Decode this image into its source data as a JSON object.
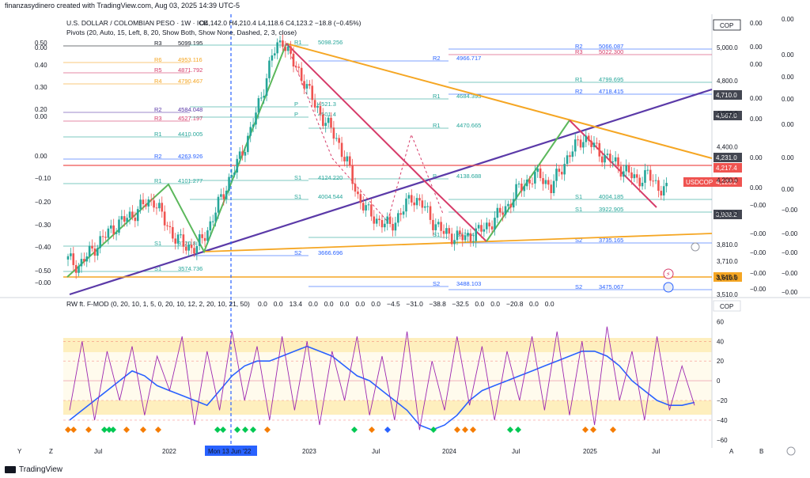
{
  "header": {
    "created_by": "finanzasydinero created with TradingView.com, Aug 03, 2025 14:39 UTC-5"
  },
  "footer": {
    "brand": "TradingView"
  },
  "legend": {
    "symbol": "U.S. DOLLAR / COLOMBIAN PESO · 1W · ICE",
    "ohlc": "O4,142.0  H4,210.4  L4,118.6  C4,123.2  −18.8 (−0.45%)",
    "pivots": "Pivots (20, Auto, 15, Left, 8, 20, Show Both, Show None, Dashed, 2, 3, close)",
    "oscillator": "RW ft. F-MOD (0, 20, 10, 1, 5, 0, 20, 10, 12, 2, 20, 10, 21, 50)",
    "osc_values": [
      "0.0",
      "0.0",
      "13.4",
      "0.0",
      "0.0",
      "0.0",
      "0.0",
      "0.0",
      "−4.5",
      "−31.0",
      "−38.8",
      "−32.5",
      "0.0",
      "0.0",
      "−20.8",
      "0.0",
      "0.0"
    ]
  },
  "colors": {
    "bull": "#26a69a",
    "bear": "#ef5350",
    "purple": "#5b3aa8",
    "orange": "#f5a623",
    "pink": "#d63c6a",
    "green": "#5cb85c",
    "blue": "#2962ff",
    "band": "#fff3c4"
  },
  "chart_data": [
    {
      "type": "candlestick",
      "title": "U.S. DOLLAR / COLOMBIAN PESO · 1W · ICE",
      "currency": "COP",
      "x_ticks": [
        "Jul",
        "2022",
        "Mon 13 Jun '22",
        "2023",
        "Jul",
        "2024",
        "Jul",
        "2025",
        "Jul"
      ],
      "y_ticks": [
        "5,000.0",
        "4,800.0",
        "4,600.0",
        "4,400.0",
        "4,200.0",
        "4,000.0",
        "3,810.0",
        "3,710.0",
        "3,610.0",
        "3,510.0"
      ],
      "y_min": 3500,
      "y_max": 5200,
      "last": {
        "label": "USDCOP",
        "value": "4,123.2"
      },
      "price_labels": [
        "4,710.0",
        "4,567.0",
        "4,231.0",
        "4,217.4",
        "3,908.2",
        "3,545.5"
      ],
      "close_path": [
        [
          0,
          3720
        ],
        [
          4,
          3680
        ],
        [
          8,
          3760
        ],
        [
          12,
          3830
        ],
        [
          16,
          3900
        ],
        [
          20,
          3950
        ],
        [
          24,
          3990
        ],
        [
          28,
          4050
        ],
        [
          32,
          4080
        ],
        [
          36,
          3950
        ],
        [
          40,
          3850
        ],
        [
          44,
          3800
        ],
        [
          48,
          3790
        ],
        [
          52,
          3900
        ],
        [
          56,
          4050
        ],
        [
          60,
          4200
        ],
        [
          64,
          4330
        ],
        [
          68,
          4500
        ],
        [
          72,
          4700
        ],
        [
          76,
          4950
        ],
        [
          80,
          5050
        ],
        [
          84,
          4900
        ],
        [
          88,
          4800
        ],
        [
          92,
          4650
        ],
        [
          96,
          4550
        ],
        [
          100,
          4450
        ],
        [
          104,
          4300
        ],
        [
          108,
          4100
        ],
        [
          112,
          4000
        ],
        [
          116,
          3950
        ],
        [
          120,
          3920
        ],
        [
          124,
          4000
        ],
        [
          128,
          4100
        ],
        [
          132,
          4050
        ],
        [
          136,
          3950
        ],
        [
          140,
          3880
        ],
        [
          144,
          3860
        ],
        [
          148,
          3850
        ],
        [
          152,
          3880
        ],
        [
          156,
          3920
        ],
        [
          160,
          3980
        ],
        [
          164,
          4050
        ],
        [
          168,
          4150
        ],
        [
          172,
          4200
        ],
        [
          176,
          4230
        ],
        [
          180,
          4150
        ],
        [
          184,
          4280
        ],
        [
          188,
          4380
        ],
        [
          192,
          4460
        ],
        [
          196,
          4400
        ],
        [
          200,
          4340
        ],
        [
          204,
          4300
        ],
        [
          208,
          4250
        ],
        [
          212,
          4200
        ],
        [
          216,
          4230
        ],
        [
          220,
          4160
        ],
        [
          224,
          4125
        ]
      ],
      "pivot_labels": [
        {
          "name": "R3",
          "value": "5099.195"
        },
        {
          "name": "R6",
          "value": "4953.116"
        },
        {
          "name": "R5",
          "value": "4871.792"
        },
        {
          "name": "R4",
          "value": "4790.467"
        },
        {
          "name": "R2",
          "value": "4584.048"
        },
        {
          "name": "R3",
          "value": "4527.197"
        },
        {
          "name": "R1",
          "value": "4410.005"
        },
        {
          "name": "R2",
          "value": "4263.926"
        },
        {
          "name": "R1",
          "value": "4101.277"
        },
        {
          "name": "S1",
          "value": "3720.8"
        },
        {
          "name": "S1",
          "value": "3574.736"
        },
        {
          "name": "R1",
          "value": "5098.256"
        },
        {
          "name": "P",
          "value": "4521.3"
        },
        {
          "name": "P",
          "value": "4501.4"
        },
        {
          "name": "S1",
          "value": "4124.220"
        },
        {
          "name": "S1",
          "value": "4004.544"
        },
        {
          "name": "S2",
          "value": "3666.696"
        },
        {
          "name": "R2",
          "value": "4966.717"
        },
        {
          "name": "R1",
          "value": "4684.393"
        },
        {
          "name": "R1",
          "value": "4470.665"
        },
        {
          "name": "P",
          "value": "4138.688"
        },
        {
          "name": "S1",
          "value": "3770.4"
        },
        {
          "name": "S2",
          "value": "3488.103"
        },
        {
          "name": "R2",
          "value": "5066.087"
        },
        {
          "name": "R3",
          "value": "5022.300"
        },
        {
          "name": "R1",
          "value": "4799.695"
        },
        {
          "name": "R2",
          "value": "4718.415"
        },
        {
          "name": "S1",
          "value": "4004.185"
        },
        {
          "name": "S1",
          "value": "3922.905"
        },
        {
          "name": "S2",
          "value": "3735.165"
        },
        {
          "name": "S2",
          "value": "3475.067"
        }
      ]
    },
    {
      "type": "line",
      "title": "RW ft. F-MOD",
      "y_ticks": [
        "60",
        "40",
        "20",
        "0",
        "−20",
        "−40",
        "−60"
      ],
      "y_min": -65,
      "y_max": 70,
      "series": [
        {
          "name": "blue",
          "values": [
            -40,
            -30,
            -20,
            -10,
            0,
            10,
            5,
            -5,
            -10,
            -15,
            -20,
            -25,
            -10,
            5,
            15,
            20,
            20,
            25,
            30,
            35,
            30,
            25,
            15,
            5,
            0,
            -10,
            -20,
            -30,
            -45,
            -50,
            -45,
            -35,
            -20,
            -10,
            -5,
            0,
            5,
            10,
            15,
            20,
            25,
            30,
            30,
            25,
            15,
            0,
            -10,
            -20,
            -25,
            -25,
            -22
          ]
        },
        {
          "name": "purple",
          "values": [
            -30,
            40,
            -40,
            30,
            -20,
            35,
            -35,
            25,
            -10,
            45,
            -45,
            30,
            -30,
            50,
            -20,
            35,
            -40,
            45,
            -30,
            40,
            -45,
            30,
            -20,
            45,
            -35,
            25,
            -40,
            50,
            -50,
            20,
            -30,
            45,
            -25,
            35,
            -40,
            30,
            -20,
            45,
            -30,
            50,
            -35,
            40,
            -45,
            55,
            -20,
            30,
            -40,
            45,
            -30,
            15,
            -25
          ]
        }
      ]
    }
  ],
  "left_axis_ticks": [
    "0.50",
    "0.00",
    "0.40",
    "0.30",
    "0.20",
    "0.00",
    "0.00",
    "−0.10",
    "−0.20",
    "−0.30",
    "−0.40",
    "−0.50",
    "−0.00"
  ],
  "right_axis_ticks": [
    "0.00",
    "0.00",
    "0.00",
    "0.00",
    "0.00",
    "0.00",
    "0.00",
    "−0.00",
    "−0.00",
    "−0.00",
    "−0.00",
    "−0.00",
    "−0.00"
  ],
  "far_right_ticks": [
    "0.00",
    "0.00",
    "0.00",
    "0.00",
    "0.00",
    "0.00",
    "0.00",
    "−0.00",
    "−0.00",
    "−0.00",
    "−0.00",
    "−0.00",
    "−0.00",
    "−0.00"
  ],
  "bottom_letters": [
    "Y",
    "Z",
    "A",
    "B",
    "C"
  ]
}
